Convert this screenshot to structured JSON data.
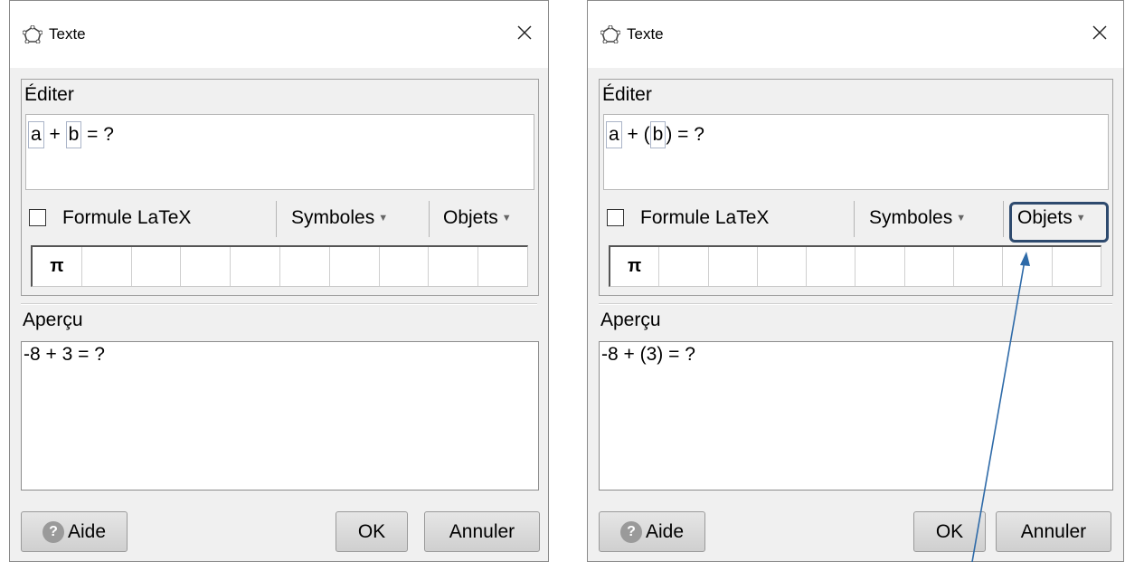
{
  "dialogs": [
    {
      "title": "Texte",
      "close_glyph": "✕",
      "edit_label": "Éditer",
      "editor_tokens": [
        {
          "text": "a",
          "chip": true
        },
        {
          "text": " + ",
          "chip": false
        },
        {
          "text": "b",
          "chip": true
        },
        {
          "text": " = ?",
          "chip": false
        }
      ],
      "latex_label": "Formule LaTeX",
      "symbols_label": "Symboles",
      "objects_label": "Objets",
      "symbols": [
        "π",
        "",
        "",
        "",
        "",
        "",
        "",
        "",
        "",
        ""
      ],
      "preview_label": "Aperçu",
      "preview_text": "-8 + 3 = ?",
      "help_label": "Aide",
      "ok_label": "OK",
      "cancel_label": "Annuler"
    },
    {
      "title": "Texte",
      "close_glyph": "✕",
      "edit_label": "Éditer",
      "editor_tokens": [
        {
          "text": "a",
          "chip": true
        },
        {
          "text": " + (",
          "chip": false
        },
        {
          "text": "b",
          "chip": true
        },
        {
          "text": ") = ?",
          "chip": false
        }
      ],
      "latex_label": "Formule LaTeX",
      "symbols_label": "Symboles",
      "objects_label": "Objets",
      "symbols": [
        "π",
        "",
        "",
        "",
        "",
        "",
        "",
        "",
        "",
        ""
      ],
      "preview_label": "Aperçu",
      "preview_text": "-8 + (3) = ?",
      "help_label": "Aide",
      "ok_label": "OK",
      "cancel_label": "Annuler"
    }
  ],
  "annotation": {
    "highlight_target": "Objets",
    "color": "#2e4a6e",
    "arrow_color": "#2e6aa8"
  }
}
